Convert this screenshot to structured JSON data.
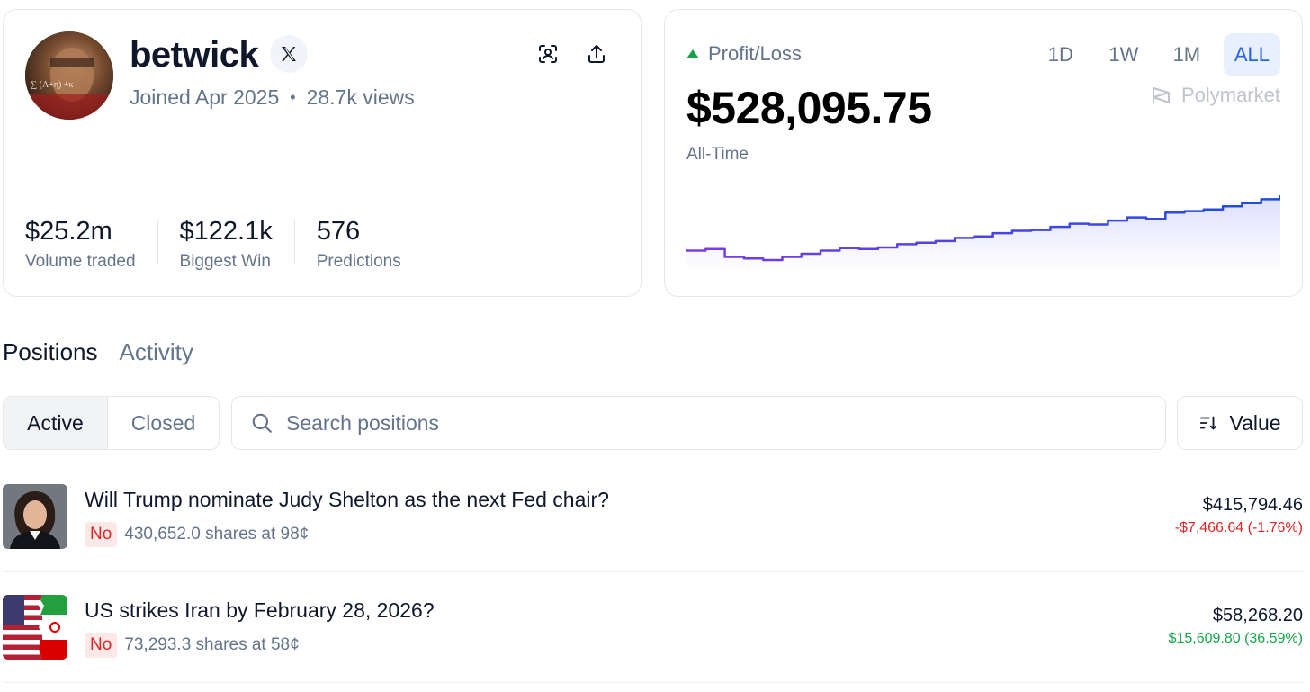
{
  "profile": {
    "username": "betwick",
    "joined": "Joined Apr 2025",
    "views": "28.7k views",
    "stats": [
      {
        "value": "$25.2m",
        "label": "Volume traded"
      },
      {
        "value": "$122.1k",
        "label": "Biggest Win"
      },
      {
        "value": "576",
        "label": "Predictions"
      }
    ]
  },
  "pnl": {
    "label": "Profit/Loss",
    "value": "$528,095.75",
    "period": "All-Time",
    "ranges": [
      "1D",
      "1W",
      "1M",
      "ALL"
    ],
    "active_range": "ALL",
    "brand": "Polymarket",
    "colors": {
      "line_start": "#7c3aed",
      "line_end": "#1d4ed8",
      "up": "#16a34a"
    }
  },
  "chart_data": {
    "type": "line",
    "title": "",
    "xlabel": "",
    "ylabel": "",
    "values": [
      0.3,
      0.32,
      0.22,
      0.2,
      0.18,
      0.22,
      0.26,
      0.3,
      0.33,
      0.32,
      0.34,
      0.38,
      0.4,
      0.42,
      0.46,
      0.48,
      0.52,
      0.55,
      0.56,
      0.6,
      0.64,
      0.63,
      0.68,
      0.72,
      0.7,
      0.78,
      0.8,
      0.82,
      0.86,
      0.9,
      0.95,
      1.0
    ],
    "grid": false,
    "legend": "none"
  },
  "tabs": {
    "positions": "Positions",
    "activity": "Activity"
  },
  "filters": {
    "active": "Active",
    "closed": "Closed"
  },
  "search": {
    "placeholder": "Search positions"
  },
  "sort": {
    "label": "Value"
  },
  "positions": [
    {
      "title": "Will Trump nominate Judy Shelton as the next Fed chair?",
      "outcome": "No",
      "shares": "430,652.0 shares at 98¢",
      "value": "$415,794.46",
      "change": "-$7,466.64 (-1.76%)",
      "change_direction": "down"
    },
    {
      "title": "US strikes Iran by February 28, 2026?",
      "outcome": "No",
      "shares": "73,293.3 shares at 58¢",
      "value": "$58,268.20",
      "change": "$15,609.80 (36.59%)",
      "change_direction": "up"
    }
  ]
}
